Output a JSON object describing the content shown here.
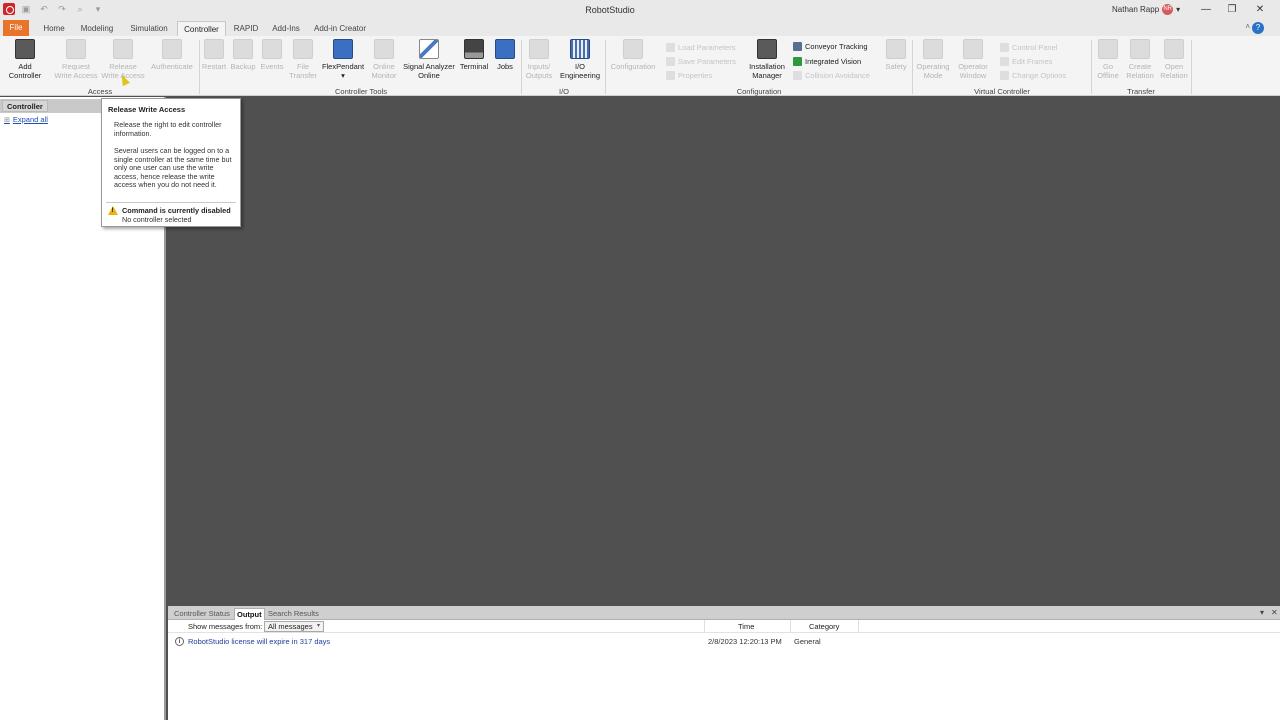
{
  "window": {
    "title": "RobotStudio",
    "user_name": "Nathan Rapp",
    "user_initials": "NR",
    "minimize": "—",
    "restore": "❐",
    "close": "✕"
  },
  "tabs": {
    "file": "File",
    "home": "Home",
    "modeling": "Modeling",
    "simulation": "Simulation",
    "controller": "Controller",
    "rapid": "RAPID",
    "addins": "Add-Ins",
    "addin_creator": "Add-in Creator",
    "help": "?"
  },
  "ribbon": {
    "access": {
      "label": "Access",
      "add_controller": "Add\nController",
      "request_write": "Request\nWrite Access",
      "release_write": "Release\nWrite Access",
      "authenticate": "Authenticate"
    },
    "controller_tools": {
      "label": "Controller Tools",
      "restart": "Restart",
      "backup": "Backup",
      "events": "Events",
      "file_transfer": "File\nTransfer",
      "flexpendant": "FlexPendant",
      "online_monitor": "Online\nMonitor",
      "signal_analyzer": "Signal Analyzer\nOnline",
      "terminal": "Terminal",
      "jobs": "Jobs"
    },
    "io": {
      "label": "I/O",
      "inputs_outputs": "Inputs/\nOutputs",
      "io_engineering": "I/O\nEngineering"
    },
    "configuration": {
      "label": "Configuration",
      "configuration": "Configuration",
      "load_parameters": "Load Parameters",
      "save_parameters": "Save Parameters",
      "properties": "Properties",
      "installation_manager": "Installation\nManager",
      "conveyor_tracking": "Conveyor Tracking",
      "integrated_vision": "Integrated Vision",
      "collision_avoidance": "Collision Avoidance",
      "safety": "Safety"
    },
    "virtual_controller": {
      "label": "Virtual Controller",
      "operating_mode": "Operating\nMode",
      "operator_window": "Operator\nWindow",
      "control_panel": "Control Panel",
      "edit_frames": "Edit Frames",
      "change_options": "Change Options"
    },
    "transfer": {
      "label": "Transfer",
      "go_offline": "Go\nOffline",
      "create_relation": "Create\nRelation",
      "open_relation": "Open\nRelation"
    }
  },
  "left_panel": {
    "tab": "Controller",
    "expand_all": "Expand all"
  },
  "tooltip": {
    "title": "Release Write Access",
    "para1": "Release the right to edit controller information.",
    "para2": "Several users can be logged on to a single controller at the same time but  only one user can use the write access, hence release the write access when you do not need it.",
    "warn_title": "Command is currently disabled",
    "warn_sub": "No controller selected"
  },
  "output": {
    "tabs": [
      "Controller Status",
      "Output",
      "Search Results"
    ],
    "show_label": "Show messages from:",
    "filter_value": "All messages",
    "col_time": "Time",
    "col_category": "Category",
    "rows": [
      {
        "message": "RobotStudio license will expire in 317 days",
        "time": "2/8/2023 12:20:13 PM",
        "category": "General"
      }
    ]
  },
  "colors": {
    "file_tab": "#e8742a",
    "workspace": "#505050",
    "link": "#1d4fb4"
  }
}
